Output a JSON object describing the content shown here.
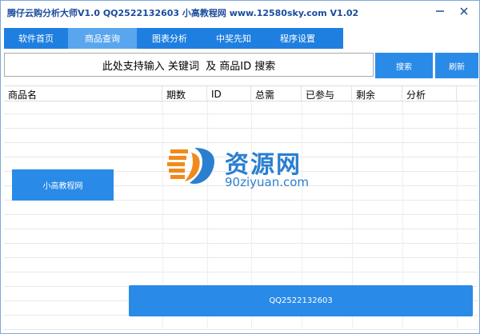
{
  "titlebar": {
    "title": "腾仔云购分析大师V1.0 QQ2522132603 小高教程网 www.12580sky.com V1.02",
    "minimize_icon": "minimize-icon",
    "close_icon": "close-icon"
  },
  "tabs": [
    {
      "label": "软件首页",
      "active": false
    },
    {
      "label": "商品查询",
      "active": true
    },
    {
      "label": "图表分析",
      "active": false
    },
    {
      "label": "中奖先知",
      "active": false
    },
    {
      "label": "程序设置",
      "active": false
    }
  ],
  "search": {
    "value": "此处支持输入 关键词  及 商品ID 搜索",
    "search_label": "搜索",
    "refresh_label": "刷新"
  },
  "table": {
    "columns": [
      "商品名",
      "期数",
      "ID",
      "总需",
      "已参与",
      "剩余",
      "分析"
    ],
    "rows": []
  },
  "watermark": {
    "title": "资源网",
    "subtitle": "90ziyuan.com"
  },
  "buttons": {
    "xiaogao_label": "小高教程网",
    "qq_label": "QQ2522132603"
  },
  "colors": {
    "accent": "#1f7fe0",
    "tab_active": "#5aa6ee",
    "button": "#2a8ae8",
    "title_text": "#1a4c9c",
    "logo_orange": "#f08a1c"
  }
}
